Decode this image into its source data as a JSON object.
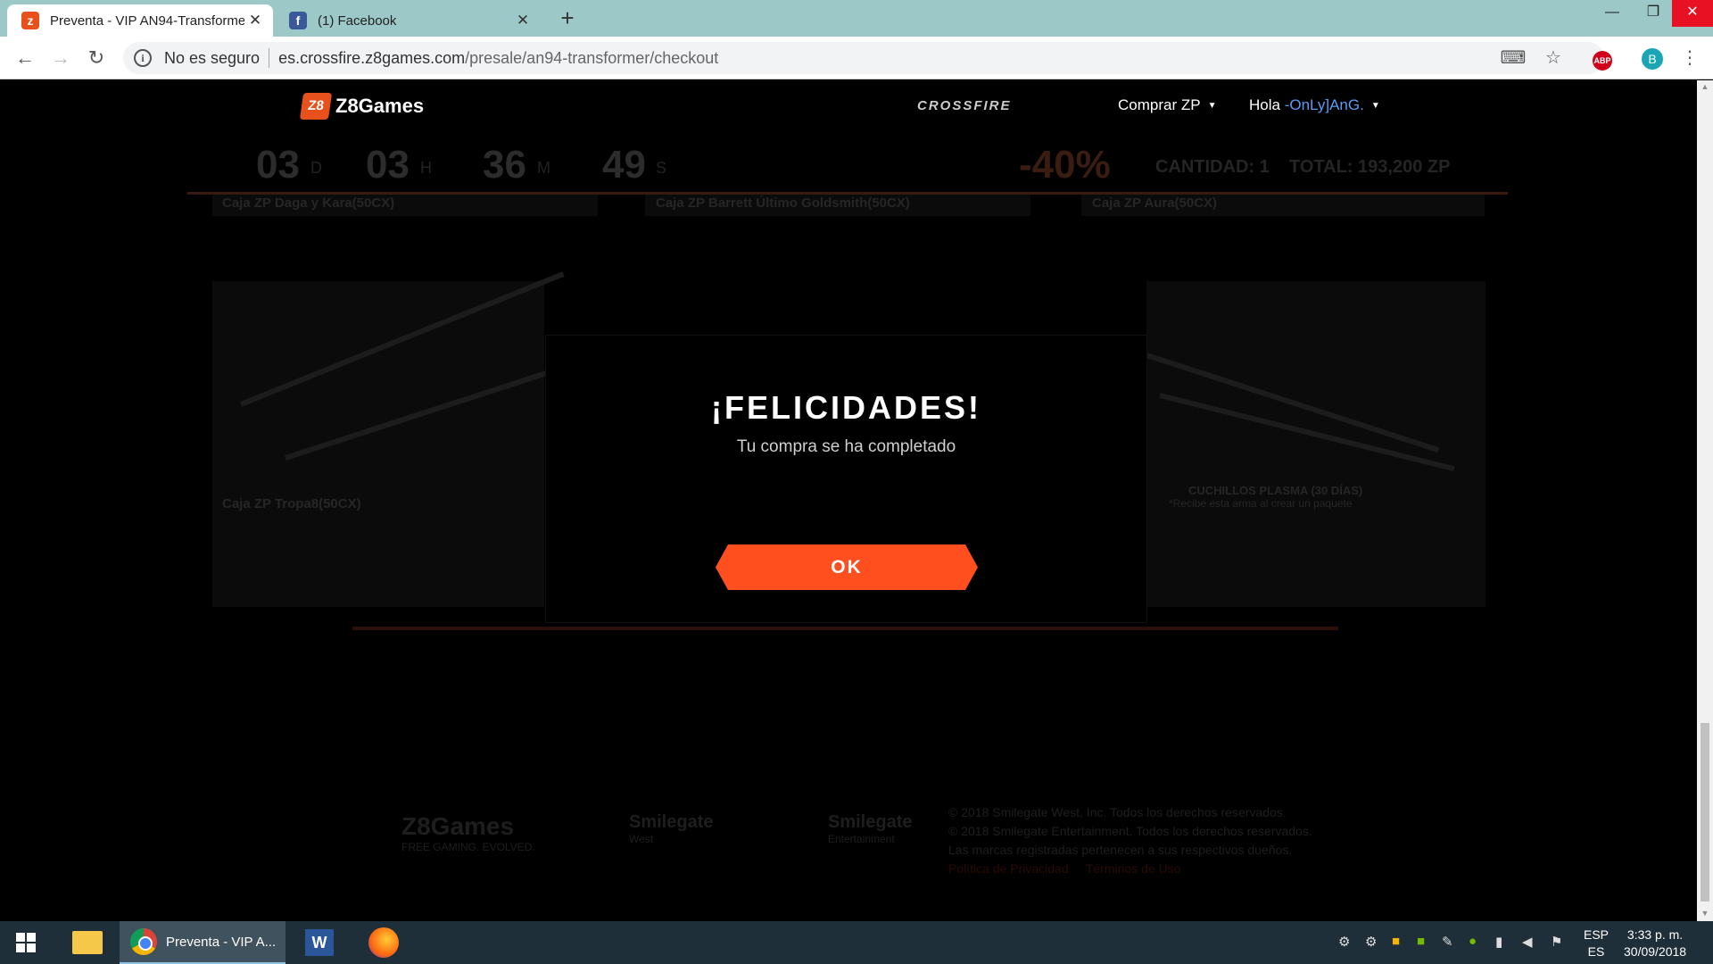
{
  "browser": {
    "tabs": [
      {
        "title": "Preventa - VIP AN94-Transforme",
        "favicon": "z8games-favicon",
        "active": true
      },
      {
        "title": "(1) Facebook",
        "favicon": "facebook-favicon",
        "active": false
      }
    ],
    "security_label": "No es seguro",
    "url_host": "es.crossfire.z8games.com",
    "url_path": "/presale/an94-transformer/checkout",
    "profile_initial": "B",
    "adblock_label": "ABP"
  },
  "site": {
    "logo_text": "Z8Games",
    "logo_mark": "Z8",
    "brand": "CROSSFIRE",
    "nav_buy": "Comprar ZP",
    "greeting": "Hola",
    "username": "-OnLy]AnG."
  },
  "background": {
    "timer": [
      {
        "value": "03",
        "unit": "D"
      },
      {
        "value": "03",
        "unit": "H"
      },
      {
        "value": "36",
        "unit": "M"
      },
      {
        "value": "49",
        "unit": "S"
      }
    ],
    "discount": "-40%",
    "quantity_label": "CANTIDAD: 1",
    "total_label": "TOTAL: 193,200 ZP",
    "items_top": [
      "Caja ZP Daga y Kara(50CX)",
      "Caja ZP Barrett Último Goldsmith(50CX)",
      "Caja ZP Aura(50CX)"
    ],
    "item_bottom_left": "Caja ZP Tropa8(50CX)",
    "item_bottom_right": "CUCHILLOS PLASMA (30 DÍAS)",
    "item_bottom_right_note": "*Recibe esta arma al crear un paquete"
  },
  "footer": {
    "logos": [
      {
        "name": "Z8Games",
        "tagline": "FREE GAMING. EVOLVED."
      },
      {
        "name": "Smilegate",
        "tagline": "West"
      },
      {
        "name": "Smilegate",
        "tagline": "Entertainment"
      }
    ],
    "copyright_lines": [
      "© 2018 Smilegate West, Inc. Todos los derechos reservados.",
      "© 2018 Smilegate Entertainment. Todos los derechos reservados.",
      "Las marcas registradas pertenecen a sus respectivos dueños."
    ],
    "links": [
      "Política de Privacidad",
      "Términos de Uso"
    ]
  },
  "modal": {
    "title": "¡FELICIDADES!",
    "subtitle": "Tu compra se ha completado",
    "ok_label": "OK",
    "accent_color": "#ff4f1f"
  },
  "taskbar": {
    "active_window": "Preventa - VIP A...",
    "lang_top": "ESP",
    "lang_bottom": "ES",
    "time": "3:33 p. m.",
    "date": "30/09/2018"
  }
}
